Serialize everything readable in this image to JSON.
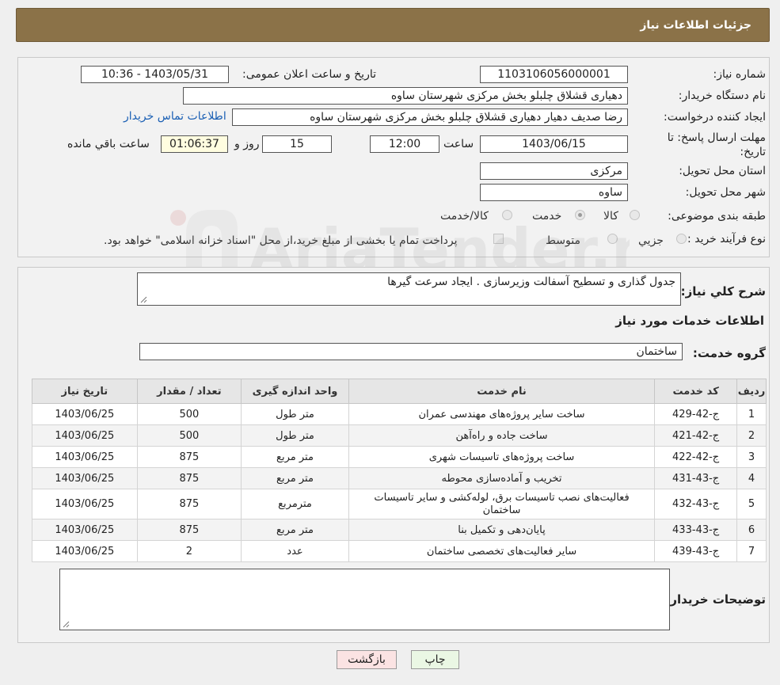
{
  "header": {
    "title": "جزئیات اطلاعات نیاز"
  },
  "form": {
    "need_number": {
      "label": "شماره نیاز:",
      "value": "1103106056000001"
    },
    "announce_datetime": {
      "label": "تاریخ و ساعت اعلان عمومی:",
      "value": "1403/05/31 - 10:36"
    },
    "buyer_org": {
      "label": "نام دستگاه خریدار:",
      "value": "دهیاری قشلاق چلبلو بخش مرکزی شهرستان ساوه"
    },
    "requester": {
      "label": "ایجاد کننده درخواست:",
      "value": "رضا صدیف دهیار دهیاری قشلاق چلبلو بخش مرکزی شهرستان ساوه",
      "contact_link": "اطلاعات تماس خریدار"
    },
    "deadline": {
      "label": "مهلت ارسال پاسخ: تا تاریخ:",
      "date": "1403/06/15",
      "time_label": "ساعت",
      "time": "12:00",
      "days": "15",
      "days_label": "روز و",
      "remaining": "01:06:37",
      "remaining_label": "ساعت باقي مانده"
    },
    "province": {
      "label": "استان محل تحویل:",
      "value": "مرکزی"
    },
    "city": {
      "label": "شهر محل تحویل:",
      "value": "ساوه"
    },
    "category": {
      "label": "طبقه بندی موضوعی:",
      "options": [
        "کالا",
        "خدمت",
        "کالا/خدمت"
      ],
      "selected": "خدمت"
    },
    "purchase_type": {
      "label": "نوع فرآیند خرید :",
      "options": [
        "جزيي",
        "متوسط"
      ],
      "payment_note": "پرداخت تمام یا بخشی از مبلغ خرید،از محل \"اسناد خزانه اسلامی\" خواهد بود."
    }
  },
  "details": {
    "summary_label": "شرح کلي نياز:",
    "summary": "جدول گذاری و تسطیح آسفالت وزیرسازی . ایجاد سرعت گیرها",
    "services_title": "اطلاعات خدمات مورد نياز",
    "service_group_label": "گروه خدمت:",
    "service_group": "ساختمان",
    "table": {
      "headers": [
        "ردیف",
        "کد خدمت",
        "نام خدمت",
        "واحد اندازه گیری",
        "تعداد / مقدار",
        "تاریخ نیاز"
      ],
      "rows": [
        [
          "1",
          "ج-42-429",
          "ساخت سایر پروژه‌های مهندسی عمران",
          "متر طول",
          "500",
          "1403/06/25"
        ],
        [
          "2",
          "ج-42-421",
          "ساخت جاده و راه‌آهن",
          "متر طول",
          "500",
          "1403/06/25"
        ],
        [
          "3",
          "ج-42-422",
          "ساخت پروژه‌های تاسیسات شهری",
          "متر مربع",
          "875",
          "1403/06/25"
        ],
        [
          "4",
          "ج-43-431",
          "تخریب و آماده‌سازی محوطه",
          "متر مربع",
          "875",
          "1403/06/25"
        ],
        [
          "5",
          "ج-43-432",
          "فعالیت‌های نصب تاسیسات برق، لوله‌کشی و سایر تاسیسات ساختمان",
          "مترمربع",
          "875",
          "1403/06/25"
        ],
        [
          "6",
          "ج-43-433",
          "پایان‌دهی و تکمیل بنا",
          "متر مربع",
          "875",
          "1403/06/25"
        ],
        [
          "7",
          "ج-43-439",
          "سایر فعالیت‌های تخصصی ساختمان",
          "عدد",
          "2",
          "1403/06/25"
        ]
      ]
    },
    "buyer_notes_label": "توضیحات خریدار:",
    "buyer_notes": ""
  },
  "buttons": {
    "print": "چاپ",
    "back": "بازگشت"
  },
  "watermark": "AriaTender.neT"
}
